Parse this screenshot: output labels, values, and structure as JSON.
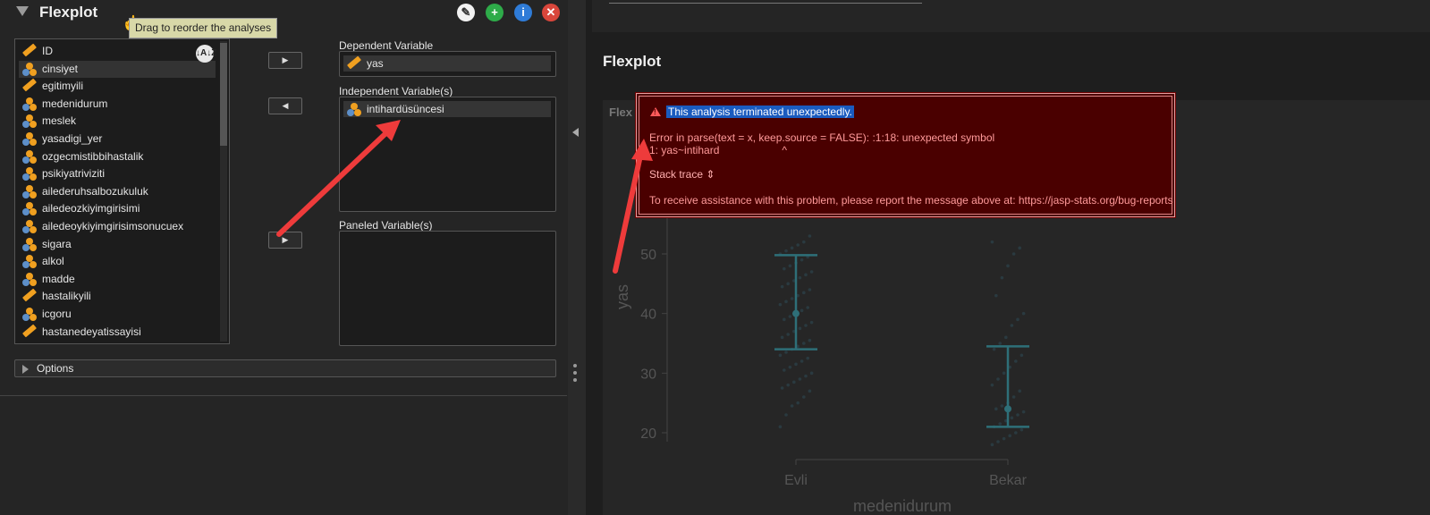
{
  "analysis": {
    "title": "Flexplot",
    "tooltip": "Drag to reorder the analyses",
    "buttons": {
      "edit": "✎",
      "add": "+",
      "info": "i",
      "close": "✕"
    }
  },
  "variables": [
    {
      "name": "ID",
      "type": "scale"
    },
    {
      "name": "cinsiyet",
      "type": "nominal"
    },
    {
      "name": "egitimyili",
      "type": "scale"
    },
    {
      "name": "medenidurum",
      "type": "nominal"
    },
    {
      "name": "meslek",
      "type": "nominal"
    },
    {
      "name": "yasadigi_yer",
      "type": "nominal"
    },
    {
      "name": "ozgecmistibbihastalik",
      "type": "nominal"
    },
    {
      "name": "psikiyatriviziti",
      "type": "nominal"
    },
    {
      "name": "ailederuhsalbozukuluk",
      "type": "nominal"
    },
    {
      "name": "ailedeozkiyimgirisimi",
      "type": "nominal"
    },
    {
      "name": "ailedeoykiyimgirisimsonucuex",
      "type": "nominal"
    },
    {
      "name": "sigara",
      "type": "nominal"
    },
    {
      "name": "alkol",
      "type": "nominal"
    },
    {
      "name": "madde",
      "type": "nominal"
    },
    {
      "name": "hastalikyili",
      "type": "scale"
    },
    {
      "name": "icgoru",
      "type": "nominal"
    },
    {
      "name": "hastanedeyatissayisi",
      "type": "scale"
    }
  ],
  "sort_label": "↓A↓Z",
  "dependent": {
    "label": "Dependent Variable",
    "value": "yas"
  },
  "independent": {
    "label": "Independent Variable(s)",
    "value": "intihardüsüncesi"
  },
  "paneled": {
    "label": "Paneled Variable(s)"
  },
  "options_label": "Options",
  "move_buttons": {
    "right": "▶",
    "left": "◀",
    "right2": "▶"
  },
  "results": {
    "title": "Flexplot",
    "plot_subtitle": "Flex"
  },
  "error": {
    "headline": "This analysis terminated unexpectedly.",
    "line1": "Error in parse(text = x, keep.source = FALSE): :1:18: unexpected symbol",
    "line2": "1: yas~intihard                     ^",
    "stack_trace": "Stack trace ⇕",
    "assist": "To receive assistance with this problem, please report the message above at: https://jasp-stats.org/bug-reports"
  },
  "chart_data": {
    "type": "scatter",
    "ylabel": "yas",
    "xlabel": "medenidurum",
    "categories": [
      "Evli",
      "Bekar"
    ],
    "y_ticks": [
      20,
      30,
      40,
      50
    ],
    "ylim": [
      16,
      66
    ],
    "summary": [
      {
        "category": "Evli",
        "center": 40,
        "lower": 34,
        "upper": 49.8
      },
      {
        "category": "Bekar",
        "center": 24,
        "lower": 21,
        "upper": 34.5
      }
    ],
    "points": {
      "Evli": [
        21,
        23,
        24.5,
        25,
        26,
        27,
        27.5,
        28,
        28.5,
        29,
        29.5,
        30,
        30.5,
        31,
        31.5,
        32,
        32.5,
        33,
        33.5,
        34,
        34.5,
        35,
        35.5,
        36,
        36.5,
        37,
        37.5,
        38,
        38.5,
        39,
        39.5,
        40,
        40.5,
        41,
        41.5,
        42,
        42.5,
        43,
        43.5,
        44,
        44.5,
        45,
        45.5,
        46,
        46.5,
        47,
        47.5,
        48,
        48.5,
        49,
        49.5,
        50,
        50.5,
        51,
        51.5,
        52,
        53
      ],
      "Bekar": [
        18,
        18.5,
        19,
        19.5,
        20,
        20.5,
        21,
        21.5,
        22,
        22.5,
        23,
        23.5,
        24,
        24.5,
        25,
        26,
        27,
        28,
        29,
        30,
        31,
        32,
        33,
        34,
        35,
        36,
        38,
        39,
        40,
        43,
        46,
        48,
        50,
        51,
        52
      ]
    },
    "colors": {
      "points": "#2a3a40",
      "bars": "#2e6f78",
      "axis": "#444"
    }
  }
}
